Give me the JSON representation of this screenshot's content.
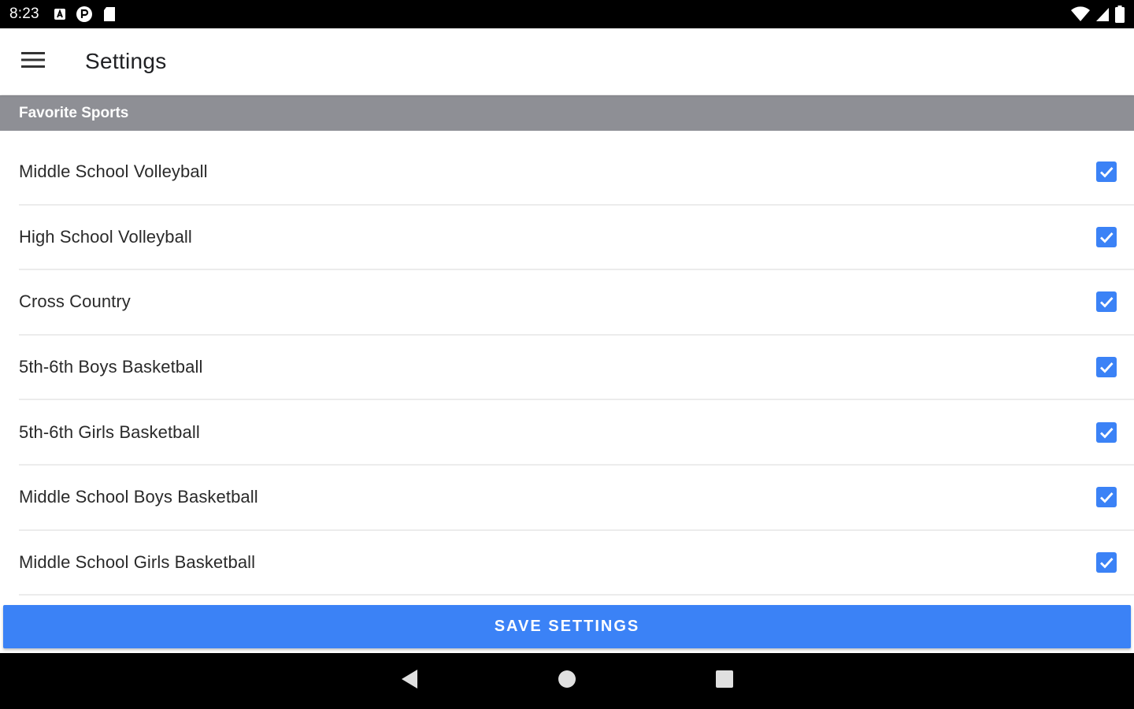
{
  "status_bar": {
    "time": "8:23",
    "left_icons": [
      "a-notification-icon",
      "p-notification-icon",
      "sd-card-icon"
    ],
    "right_icons": [
      "wifi-icon",
      "signal-icon",
      "battery-icon"
    ]
  },
  "app_bar": {
    "title": "Settings",
    "menu_icon": "hamburger-menu-icon"
  },
  "section": {
    "title": "Favorite Sports"
  },
  "sports": [
    {
      "label": "Middle School Volleyball",
      "checked": true
    },
    {
      "label": "High School Volleyball",
      "checked": true
    },
    {
      "label": "Cross Country",
      "checked": true
    },
    {
      "label": "5th-6th Boys Basketball",
      "checked": true
    },
    {
      "label": "5th-6th Girls Basketball",
      "checked": true
    },
    {
      "label": "Middle School Boys Basketball",
      "checked": true
    },
    {
      "label": "Middle School Girls Basketball",
      "checked": true
    }
  ],
  "save_button": {
    "label": "SAVE SETTINGS"
  },
  "nav_bar": {
    "icons": [
      "back-icon",
      "home-icon",
      "recents-icon"
    ]
  },
  "colors": {
    "accent": "#3b82f6",
    "section_header_bg": "#8e8f95",
    "status_bar_bg": "#000000",
    "checkbox": "#3b82f6"
  }
}
